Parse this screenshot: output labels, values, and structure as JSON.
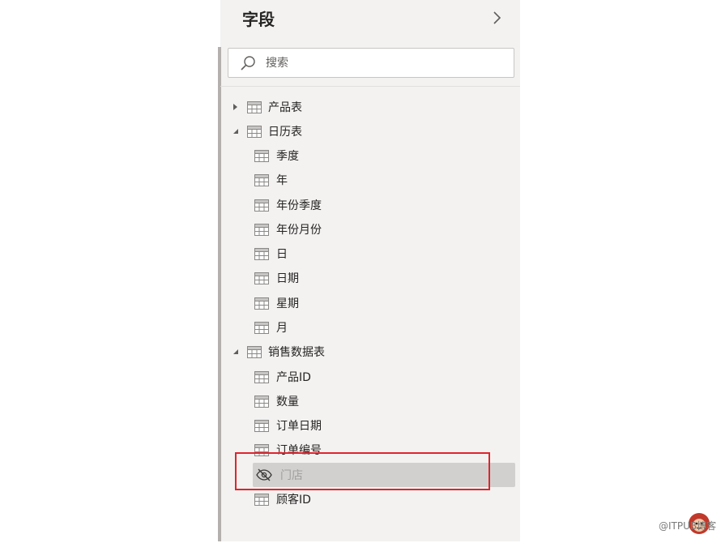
{
  "panel": {
    "title": "字段",
    "collapse_icon": "chevron-right-icon",
    "search": {
      "placeholder": "搜索",
      "value": "",
      "icon": "search-icon"
    }
  },
  "tables": [
    {
      "name": "产品表",
      "expanded": false,
      "fields": []
    },
    {
      "name": "日历表",
      "expanded": true,
      "fields": [
        "季度",
        "年",
        "年份季度",
        "年份月份",
        "日",
        "日期",
        "星期",
        "月"
      ]
    },
    {
      "name": "销售数据表",
      "expanded": true,
      "fields": [
        "产品ID",
        "数量",
        "订单日期",
        "订单编号",
        "门店",
        "顾客ID"
      ]
    }
  ],
  "hidden_field": "门店",
  "watermark": "@ITPUB博客",
  "logo_text": "猴子",
  "colors": {
    "highlight_border": "#e0242c",
    "hidden_row_bg": "#d2d0ce",
    "panel_bg": "#f3f2f1"
  }
}
